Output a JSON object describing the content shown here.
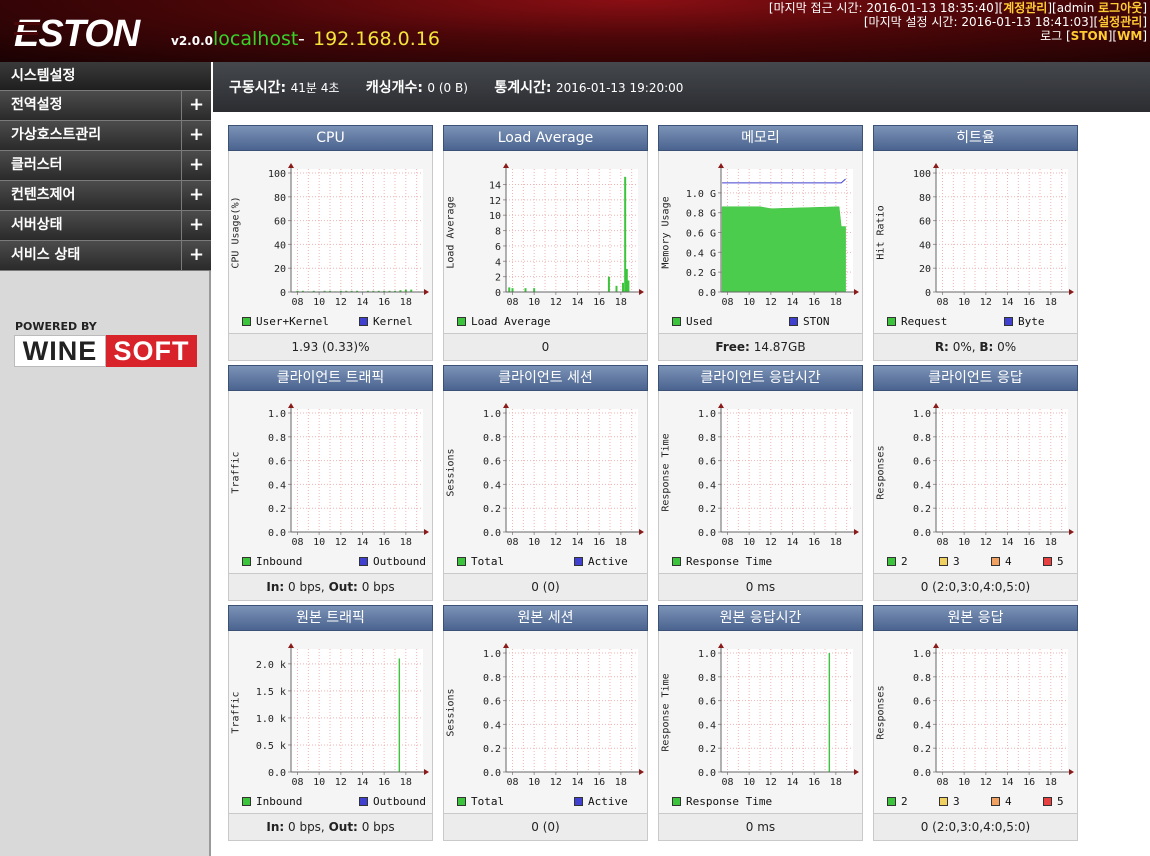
{
  "header": {
    "version": "v2.0.0",
    "hostname": "localhost",
    "separator": "-",
    "ip": "192.168.0.16",
    "line1_prefix": "[마지막 접근 시간: 2016-01-13 18:35:40][",
    "line1_account": "계정관리",
    "line1_mid": "][admin ",
    "line1_logout": "로그아웃",
    "line1_end": "]",
    "line2_prefix": "[마지막 설정 시간: 2016-01-13 18:41:03][",
    "line2_settings": "설정관리",
    "line2_end": "]",
    "line3_prefix": "로그 [",
    "line3_ston": "STON",
    "line3_mid": "][",
    "line3_wm": "WM",
    "line3_end": "]"
  },
  "sidebar": {
    "items": [
      {
        "label": "시스템설정",
        "has_plus": false
      },
      {
        "label": "전역설정",
        "has_plus": true
      },
      {
        "label": "가상호스트관리",
        "has_plus": true
      },
      {
        "label": "클러스터",
        "has_plus": true
      },
      {
        "label": "컨텐츠제어",
        "has_plus": true
      },
      {
        "label": "서버상태",
        "has_plus": true
      },
      {
        "label": "서비스 상태",
        "has_plus": true
      }
    ],
    "plus_symbol": "+",
    "powered_by": "POWERED BY",
    "brand_left": "WINE",
    "brand_right": "SOFT"
  },
  "status": {
    "uptime_label": "구동시간:",
    "uptime_value": "41분 4초",
    "cache_label": "캐싱개수:",
    "cache_value": "0 (0 B)",
    "stats_label": "통계시간:",
    "stats_value": "2016-01-13 19:20:00"
  },
  "colors": {
    "green": "#3cc43c",
    "blue": "#4040d0",
    "yellow": "#f0d060",
    "orange": "#f0a060",
    "red": "#e84040",
    "title_bar": "#5b74a0"
  },
  "panels": [
    {
      "title": "CPU",
      "ylabel": "CPU Usage(%)",
      "yticks": [
        "100",
        "80",
        "60",
        "40",
        "20",
        "0"
      ],
      "ymax": 100,
      "legend": [
        {
          "label": "User+Kernel",
          "color": "green"
        },
        {
          "label": "Kernel",
          "color": "blue"
        }
      ],
      "footer": "1.93 (0.33)%",
      "chart_data": {
        "type": "bar",
        "x": [
          8.0,
          8.5,
          9.0,
          9.5,
          10.0,
          10.5,
          11.0,
          11.5,
          12.0,
          12.5,
          13.0,
          13.5,
          14.0,
          14.5,
          15.0,
          15.5,
          16.0,
          16.5,
          17.0,
          17.5,
          18.0,
          18.5
        ],
        "values": [
          1,
          1,
          0.5,
          1,
          0.5,
          1,
          1,
          0.5,
          1,
          1,
          1,
          1,
          0.5,
          1,
          1,
          1,
          1,
          1,
          1,
          1.5,
          2,
          2
        ]
      }
    },
    {
      "title": "Load Average",
      "ylabel": "Load Average",
      "yticks": [
        "14",
        "12",
        "10",
        "8",
        "6",
        "4",
        "2",
        "0"
      ],
      "ymax": 15.5,
      "legend": [
        {
          "label": "Load Average",
          "color": "green"
        }
      ],
      "footer": "0",
      "chart_data": {
        "type": "bar",
        "x": [
          7.7,
          8.0,
          9.2,
          10.0,
          16.9,
          17.6,
          18.2,
          18.4,
          18.55,
          18.7
        ],
        "values": [
          0.6,
          0.5,
          0.5,
          0.5,
          2.0,
          0.8,
          1.2,
          15.0,
          3.0,
          1.5
        ]
      }
    },
    {
      "title": "메모리",
      "ylabel": "Memory Usage",
      "yticks": [
        "1.0 G",
        "0.8 G",
        "0.6 G",
        "0.4 G",
        "0.2 G",
        "0.0"
      ],
      "ymax": 1.2,
      "legend": [
        {
          "label": "Used",
          "color": "green"
        },
        {
          "label": "STON",
          "color": "blue"
        }
      ],
      "footer_bold": "Free:",
      "footer": "14.87GB",
      "chart_data": {
        "type": "area",
        "x": [
          7.5,
          11.0,
          12.0,
          18.3,
          18.5,
          18.9
        ],
        "used": [
          0.86,
          0.86,
          0.84,
          0.86,
          0.66,
          0.66
        ],
        "ston": [
          1.1,
          1.1,
          1.1,
          1.1,
          1.1,
          1.14
        ]
      }
    },
    {
      "title": "히트율",
      "ylabel": "Hit Ratio",
      "yticks": [
        "100",
        "80",
        "60",
        "40",
        "20",
        "0"
      ],
      "ymax": 100,
      "legend": [
        {
          "label": "Request",
          "color": "green"
        },
        {
          "label": "Byte",
          "color": "blue"
        }
      ],
      "footer_bold": "R:",
      "footer": "0%, ",
      "footer_bold2": "B:",
      "footer2": "0%",
      "chart_data": {
        "type": "line",
        "values": []
      }
    },
    {
      "title": "클라이언트 트래픽",
      "ylabel": "Traffic",
      "yticks": [
        "1.0",
        "0.8",
        "0.6",
        "0.4",
        "0.2",
        "0.0"
      ],
      "ymax": 1,
      "legend": [
        {
          "label": "Inbound",
          "color": "green"
        },
        {
          "label": "Outbound",
          "color": "blue"
        }
      ],
      "footer_bold": "In:",
      "footer": "0 bps, ",
      "footer_bold2": "Out:",
      "footer2": "0 bps",
      "chart_data": {
        "type": "line",
        "values": []
      }
    },
    {
      "title": "클라이언트 세션",
      "ylabel": "Sessions",
      "yticks": [
        "1.0",
        "0.8",
        "0.6",
        "0.4",
        "0.2",
        "0.0"
      ],
      "ymax": 1,
      "legend": [
        {
          "label": "Total",
          "color": "green"
        },
        {
          "label": "Active",
          "color": "blue"
        }
      ],
      "footer": "0 (0)",
      "chart_data": {
        "type": "line",
        "values": []
      }
    },
    {
      "title": "클라이언트 응답시간",
      "ylabel": "Response Time",
      "yticks": [
        "1.0",
        "0.8",
        "0.6",
        "0.4",
        "0.2",
        "0.0"
      ],
      "ymax": 1,
      "legend": [
        {
          "label": "Response Time",
          "color": "green"
        }
      ],
      "footer": "0 ms",
      "chart_data": {
        "type": "line",
        "values": []
      }
    },
    {
      "title": "클라이언트 응답",
      "ylabel": "Responses",
      "yticks": [
        "1.0",
        "0.8",
        "0.6",
        "0.4",
        "0.2",
        "0.0"
      ],
      "ymax": 1,
      "legend": [
        {
          "label": "2",
          "color": "green"
        },
        {
          "label": "3",
          "color": "yellow"
        },
        {
          "label": "4",
          "color": "orange"
        },
        {
          "label": "5",
          "color": "red"
        }
      ],
      "footer": "0 (2:0,3:0,4:0,5:0)",
      "chart_data": {
        "type": "line",
        "values": []
      }
    },
    {
      "title": "원본 트래픽",
      "ylabel": "Traffic",
      "yticks": [
        "2.0 k",
        "1.5 k",
        "1.0 k",
        "0.5 k",
        "0.0"
      ],
      "ymax": 2.2,
      "legend": [
        {
          "label": "Inbound",
          "color": "green"
        },
        {
          "label": "Outbound",
          "color": "blue"
        }
      ],
      "footer_bold": "In:",
      "footer": "0 bps, ",
      "footer_bold2": "Out:",
      "footer2": "0 bps",
      "chart_data": {
        "type": "bar",
        "x": [
          17.4
        ],
        "values": [
          2.1
        ]
      }
    },
    {
      "title": "원본 세션",
      "ylabel": "Sessions",
      "yticks": [
        "1.0",
        "0.8",
        "0.6",
        "0.4",
        "0.2",
        "0.0"
      ],
      "ymax": 1,
      "legend": [
        {
          "label": "Total",
          "color": "green"
        },
        {
          "label": "Active",
          "color": "blue"
        }
      ],
      "footer": "0 (0)",
      "chart_data": {
        "type": "line",
        "values": []
      }
    },
    {
      "title": "원본 응답시간",
      "ylabel": "Response Time",
      "yticks": [
        "1.0",
        "0.8",
        "0.6",
        "0.4",
        "0.2",
        "0.0"
      ],
      "ymax": 1,
      "legend": [
        {
          "label": "Response Time",
          "color": "green"
        }
      ],
      "footer": "0 ms",
      "chart_data": {
        "type": "bar",
        "x": [
          17.4
        ],
        "values": [
          1.0
        ]
      }
    },
    {
      "title": "원본 응답",
      "ylabel": "Responses",
      "yticks": [
        "1.0",
        "0.8",
        "0.6",
        "0.4",
        "0.2",
        "0.0"
      ],
      "ymax": 1,
      "legend": [
        {
          "label": "2",
          "color": "green"
        },
        {
          "label": "3",
          "color": "yellow"
        },
        {
          "label": "4",
          "color": "orange"
        },
        {
          "label": "5",
          "color": "red"
        }
      ],
      "footer": "0 (2:0,3:0,4:0,5:0)",
      "chart_data": {
        "type": "line",
        "values": []
      }
    }
  ],
  "xticks": [
    "08",
    "10",
    "12",
    "14",
    "16",
    "18"
  ]
}
